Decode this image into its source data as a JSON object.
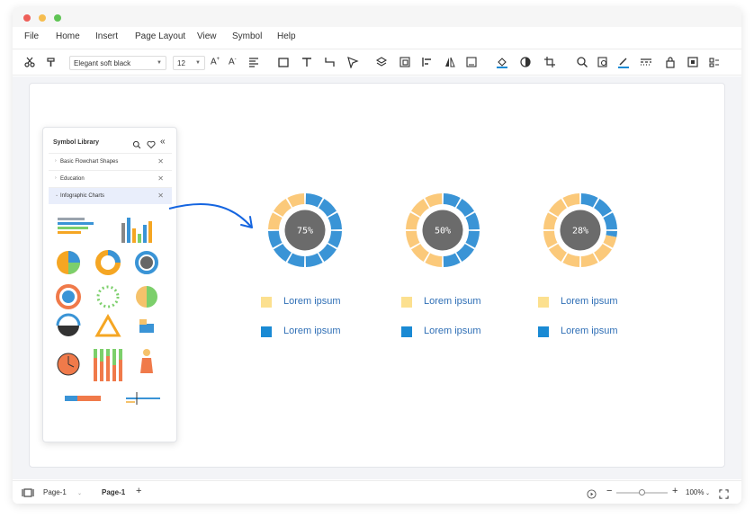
{
  "window": {
    "traffic_colors": [
      "#ee5f59",
      "#f6bd4f",
      "#5fc454"
    ]
  },
  "menu": {
    "items": [
      "File",
      "Home",
      "Insert",
      "Page Layout",
      "View",
      "Symbol",
      "Help"
    ]
  },
  "toolbar": {
    "font_name": "Elegant soft black",
    "font_size": "12",
    "icons": [
      "cut-icon",
      "format-painter-icon",
      "increase-font-icon",
      "decrease-font-icon",
      "align-icon",
      "rectangle-icon",
      "text-icon",
      "connector-icon",
      "pointer-icon",
      "layers-icon",
      "group-icon",
      "align-left-icon",
      "flip-icon",
      "frame-icon",
      "fill-icon",
      "shape-fill-icon",
      "crop-icon",
      "search-icon",
      "zoom-page-icon",
      "line-color-icon",
      "line-style-icon",
      "lock-icon",
      "fit-icon",
      "more-icon"
    ]
  },
  "library": {
    "title": "Symbol Library",
    "categories": [
      {
        "label": "Basic Flowchart Shapes",
        "selected": false
      },
      {
        "label": "Education",
        "selected": false
      },
      {
        "label": "Infographic Charts",
        "selected": true
      }
    ]
  },
  "colors": {
    "light": "#fbc97a",
    "dark": "#3a94d6",
    "center": "#6b6b6b",
    "swatch_light": "#fce08f",
    "swatch_dark": "#1a8ad4",
    "legend_text": "#2f6fb6",
    "arrow": "#1565e0"
  },
  "charts": [
    {
      "label": "75%",
      "value": 0.75,
      "legend": [
        "Lorem  ipsum",
        "Lorem  ipsum"
      ]
    },
    {
      "label": "50%",
      "value": 0.5,
      "legend": [
        "Lorem  ipsum",
        "Lorem  ipsum"
      ]
    },
    {
      "label": "28%",
      "value": 0.28,
      "legend": [
        "Lorem  ipsum",
        "Lorem  ipsum"
      ]
    }
  ],
  "status": {
    "page_select": "Page-1",
    "active_tab": "Page-1",
    "zoom": "100%",
    "zoom_level": 0.5
  }
}
